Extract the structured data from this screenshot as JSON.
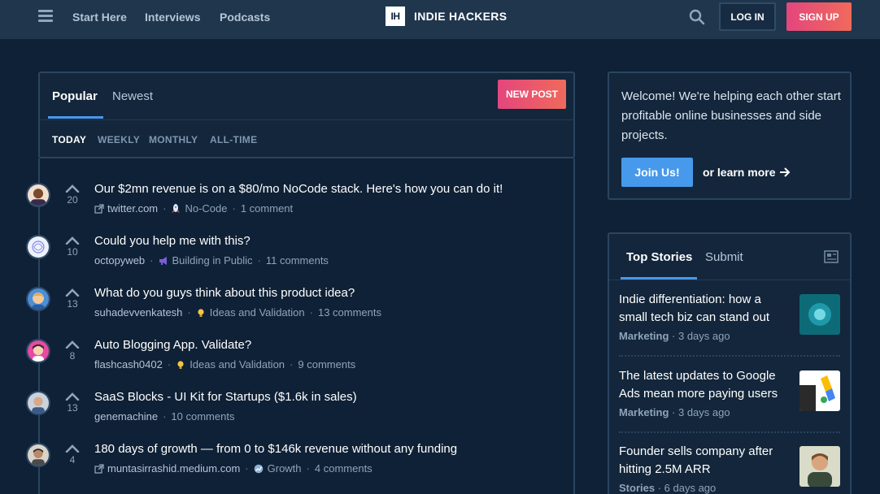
{
  "header": {
    "nav": [
      "Start Here",
      "Interviews",
      "Podcasts"
    ],
    "brand_logo": "IH",
    "brand_name": "INDIE HACKERS",
    "login_label": "LOG IN",
    "signup_label": "SIGN UP"
  },
  "feed": {
    "tabs": [
      "Popular",
      "Newest"
    ],
    "active_tab": "Popular",
    "new_post_label": "NEW POST",
    "periods": [
      "TODAY",
      "WEEKLY",
      "MONTHLY",
      "ALL-TIME"
    ],
    "active_period": "TODAY",
    "posts": [
      {
        "votes": "20",
        "title": "Our $2mn revenue is on a $80/mo NoCode stack. Here's how you can do it!",
        "source": "twitter.com",
        "external": true,
        "group": "No-Code",
        "group_icon": "rocket-icon",
        "comments": "1 comment"
      },
      {
        "votes": "10",
        "title": "Could you help me with this?",
        "source": "octopyweb",
        "external": false,
        "group": "Building in Public",
        "group_icon": "megaphone-icon",
        "comments": "11 comments"
      },
      {
        "votes": "13",
        "title": "What do you guys think about this product idea?",
        "source": "suhadevvenkatesh",
        "external": false,
        "group": "Ideas and Validation",
        "group_icon": "lightbulb-icon",
        "comments": "13 comments"
      },
      {
        "votes": "8",
        "title": "Auto Blogging App. Validate?",
        "source": "flashcash0402",
        "external": false,
        "group": "Ideas and Validation",
        "group_icon": "lightbulb-icon",
        "comments": "9 comments"
      },
      {
        "votes": "13",
        "title": "SaaS Blocks - UI Kit for Startups ($1.6k in sales)",
        "source": "genemachine",
        "external": false,
        "group": "",
        "group_icon": "",
        "comments": "10 comments"
      },
      {
        "votes": "4",
        "title": "180 days of growth — from 0 to $146k revenue without any funding",
        "source": "muntasirrashid.medium.com",
        "external": true,
        "group": "Growth",
        "group_icon": "growth-icon",
        "comments": "4 comments"
      }
    ]
  },
  "welcome": {
    "text": "Welcome! We're helping each other start profitable online businesses and side projects.",
    "join_label": "Join Us!",
    "learn_more": "or learn more"
  },
  "stories": {
    "tabs": [
      "Top Stories",
      "Submit"
    ],
    "active_tab": "Top Stories",
    "items": [
      {
        "title": "Indie differentiation: how a small tech biz can stand out",
        "category": "Marketing",
        "age": "3 days ago"
      },
      {
        "title": "The latest updates to Google Ads mean more paying users",
        "category": "Marketing",
        "age": "3 days ago"
      },
      {
        "title": "Founder sells company after hitting 2.5M ARR",
        "category": "Stories",
        "age": "6 days ago"
      }
    ]
  },
  "colors": {
    "background": "#0f2136",
    "header": "#1f364d",
    "accent_blue": "#4799eb",
    "accent_pink": "#e3467d"
  }
}
